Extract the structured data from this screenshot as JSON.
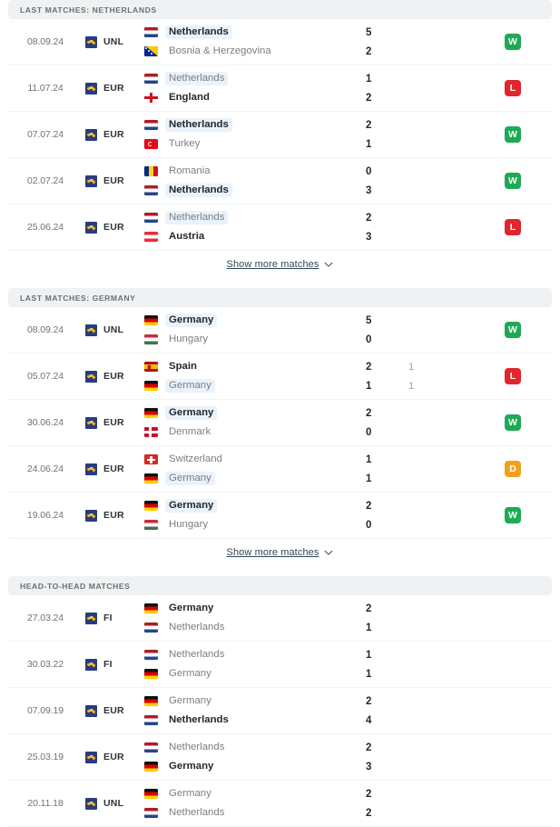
{
  "colors": {
    "win": "#1eaa55",
    "loss": "#e0252b",
    "draw": "#f0a11c",
    "header_bg": "#f0f1f2",
    "highlight_bg": "#eaf2fb",
    "link": "#2f4858"
  },
  "show_more": {
    "label": "Show more matches",
    "icon": "chevron-down-icon"
  },
  "sections": [
    {
      "id": "last-matches-netherlands",
      "title": "LAST MATCHES: NETHERLANDS",
      "has_show_more": true,
      "has_results": true,
      "matches": [
        {
          "date": "08.09.24",
          "competition": "UNL",
          "competition_icon": "uefa-icon",
          "home": {
            "team": "Netherlands",
            "flag": "netherlands",
            "winner": true,
            "highlight": true,
            "score": "5",
            "score_sub": ""
          },
          "away": {
            "team": "Bosnia & Herzegovina",
            "flag": "bosnia",
            "winner": false,
            "highlight": false,
            "score": "2",
            "score_sub": ""
          },
          "result": "W"
        },
        {
          "date": "11.07.24",
          "competition": "EUR",
          "competition_icon": "uefa-icon",
          "home": {
            "team": "Netherlands",
            "flag": "netherlands",
            "winner": false,
            "highlight": true,
            "score": "1",
            "score_sub": ""
          },
          "away": {
            "team": "England",
            "flag": "england",
            "winner": true,
            "highlight": false,
            "score": "2",
            "score_sub": ""
          },
          "result": "L"
        },
        {
          "date": "07.07.24",
          "competition": "EUR",
          "competition_icon": "uefa-icon",
          "home": {
            "team": "Netherlands",
            "flag": "netherlands",
            "winner": true,
            "highlight": true,
            "score": "2",
            "score_sub": ""
          },
          "away": {
            "team": "Turkey",
            "flag": "turkey",
            "winner": false,
            "highlight": false,
            "score": "1",
            "score_sub": ""
          },
          "result": "W"
        },
        {
          "date": "02.07.24",
          "competition": "EUR",
          "competition_icon": "uefa-icon",
          "home": {
            "team": "Romania",
            "flag": "romania",
            "winner": false,
            "highlight": false,
            "score": "0",
            "score_sub": ""
          },
          "away": {
            "team": "Netherlands",
            "flag": "netherlands",
            "winner": true,
            "highlight": true,
            "score": "3",
            "score_sub": ""
          },
          "result": "W"
        },
        {
          "date": "25.06.24",
          "competition": "EUR",
          "competition_icon": "uefa-icon",
          "home": {
            "team": "Netherlands",
            "flag": "netherlands",
            "winner": false,
            "highlight": true,
            "score": "2",
            "score_sub": ""
          },
          "away": {
            "team": "Austria",
            "flag": "austria",
            "winner": true,
            "highlight": false,
            "score": "3",
            "score_sub": ""
          },
          "result": "L"
        }
      ]
    },
    {
      "id": "last-matches-germany",
      "title": "LAST MATCHES: GERMANY",
      "has_show_more": true,
      "has_results": true,
      "matches": [
        {
          "date": "08.09.24",
          "competition": "UNL",
          "competition_icon": "uefa-icon",
          "home": {
            "team": "Germany",
            "flag": "germany",
            "winner": true,
            "highlight": true,
            "score": "5",
            "score_sub": ""
          },
          "away": {
            "team": "Hungary",
            "flag": "hungary",
            "winner": false,
            "highlight": false,
            "score": "0",
            "score_sub": ""
          },
          "result": "W"
        },
        {
          "date": "05.07.24",
          "competition": "EUR",
          "competition_icon": "uefa-icon",
          "home": {
            "team": "Spain",
            "flag": "spain",
            "winner": true,
            "highlight": false,
            "score": "2",
            "score_sub": "1"
          },
          "away": {
            "team": "Germany",
            "flag": "germany",
            "winner": false,
            "highlight": true,
            "score": "1",
            "score_sub": "1"
          },
          "result": "L"
        },
        {
          "date": "30.06.24",
          "competition": "EUR",
          "competition_icon": "uefa-icon",
          "home": {
            "team": "Germany",
            "flag": "germany",
            "winner": true,
            "highlight": true,
            "score": "2",
            "score_sub": ""
          },
          "away": {
            "team": "Denmark",
            "flag": "denmark",
            "winner": false,
            "highlight": false,
            "score": "0",
            "score_sub": ""
          },
          "result": "W"
        },
        {
          "date": "24.06.24",
          "competition": "EUR",
          "competition_icon": "uefa-icon",
          "home": {
            "team": "Switzerland",
            "flag": "switzerland",
            "winner": false,
            "highlight": false,
            "score": "1",
            "score_sub": ""
          },
          "away": {
            "team": "Germany",
            "flag": "germany",
            "winner": false,
            "highlight": true,
            "score": "1",
            "score_sub": ""
          },
          "result": "D"
        },
        {
          "date": "19.06.24",
          "competition": "EUR",
          "competition_icon": "uefa-icon",
          "home": {
            "team": "Germany",
            "flag": "germany",
            "winner": true,
            "highlight": true,
            "score": "2",
            "score_sub": ""
          },
          "away": {
            "team": "Hungary",
            "flag": "hungary",
            "winner": false,
            "highlight": false,
            "score": "0",
            "score_sub": ""
          },
          "result": "W"
        }
      ]
    },
    {
      "id": "head-to-head-matches",
      "title": "HEAD-TO-HEAD MATCHES",
      "has_show_more": false,
      "has_results": false,
      "matches": [
        {
          "date": "27.03.24",
          "competition": "FI",
          "competition_icon": "uefa-icon",
          "home": {
            "team": "Germany",
            "flag": "germany",
            "winner": true,
            "highlight": false,
            "score": "2",
            "score_sub": ""
          },
          "away": {
            "team": "Netherlands",
            "flag": "netherlands",
            "winner": false,
            "highlight": false,
            "score": "1",
            "score_sub": ""
          },
          "result": ""
        },
        {
          "date": "30.03.22",
          "competition": "FI",
          "competition_icon": "uefa-icon",
          "home": {
            "team": "Netherlands",
            "flag": "netherlands",
            "winner": false,
            "highlight": false,
            "score": "1",
            "score_sub": ""
          },
          "away": {
            "team": "Germany",
            "flag": "germany",
            "winner": false,
            "highlight": false,
            "score": "1",
            "score_sub": ""
          },
          "result": ""
        },
        {
          "date": "07.09.19",
          "competition": "EUR",
          "competition_icon": "uefa-icon",
          "home": {
            "team": "Germany",
            "flag": "germany",
            "winner": false,
            "highlight": false,
            "score": "2",
            "score_sub": ""
          },
          "away": {
            "team": "Netherlands",
            "flag": "netherlands",
            "winner": true,
            "highlight": false,
            "score": "4",
            "score_sub": ""
          },
          "result": ""
        },
        {
          "date": "25.03.19",
          "competition": "EUR",
          "competition_icon": "uefa-icon",
          "home": {
            "team": "Netherlands",
            "flag": "netherlands",
            "winner": false,
            "highlight": false,
            "score": "2",
            "score_sub": ""
          },
          "away": {
            "team": "Germany",
            "flag": "germany",
            "winner": true,
            "highlight": false,
            "score": "3",
            "score_sub": ""
          },
          "result": ""
        },
        {
          "date": "20.11.18",
          "competition": "UNL",
          "competition_icon": "uefa-icon",
          "home": {
            "team": "Germany",
            "flag": "germany",
            "winner": false,
            "highlight": false,
            "score": "2",
            "score_sub": ""
          },
          "away": {
            "team": "Netherlands",
            "flag": "netherlands",
            "winner": false,
            "highlight": false,
            "score": "2",
            "score_sub": ""
          },
          "result": ""
        }
      ]
    }
  ]
}
